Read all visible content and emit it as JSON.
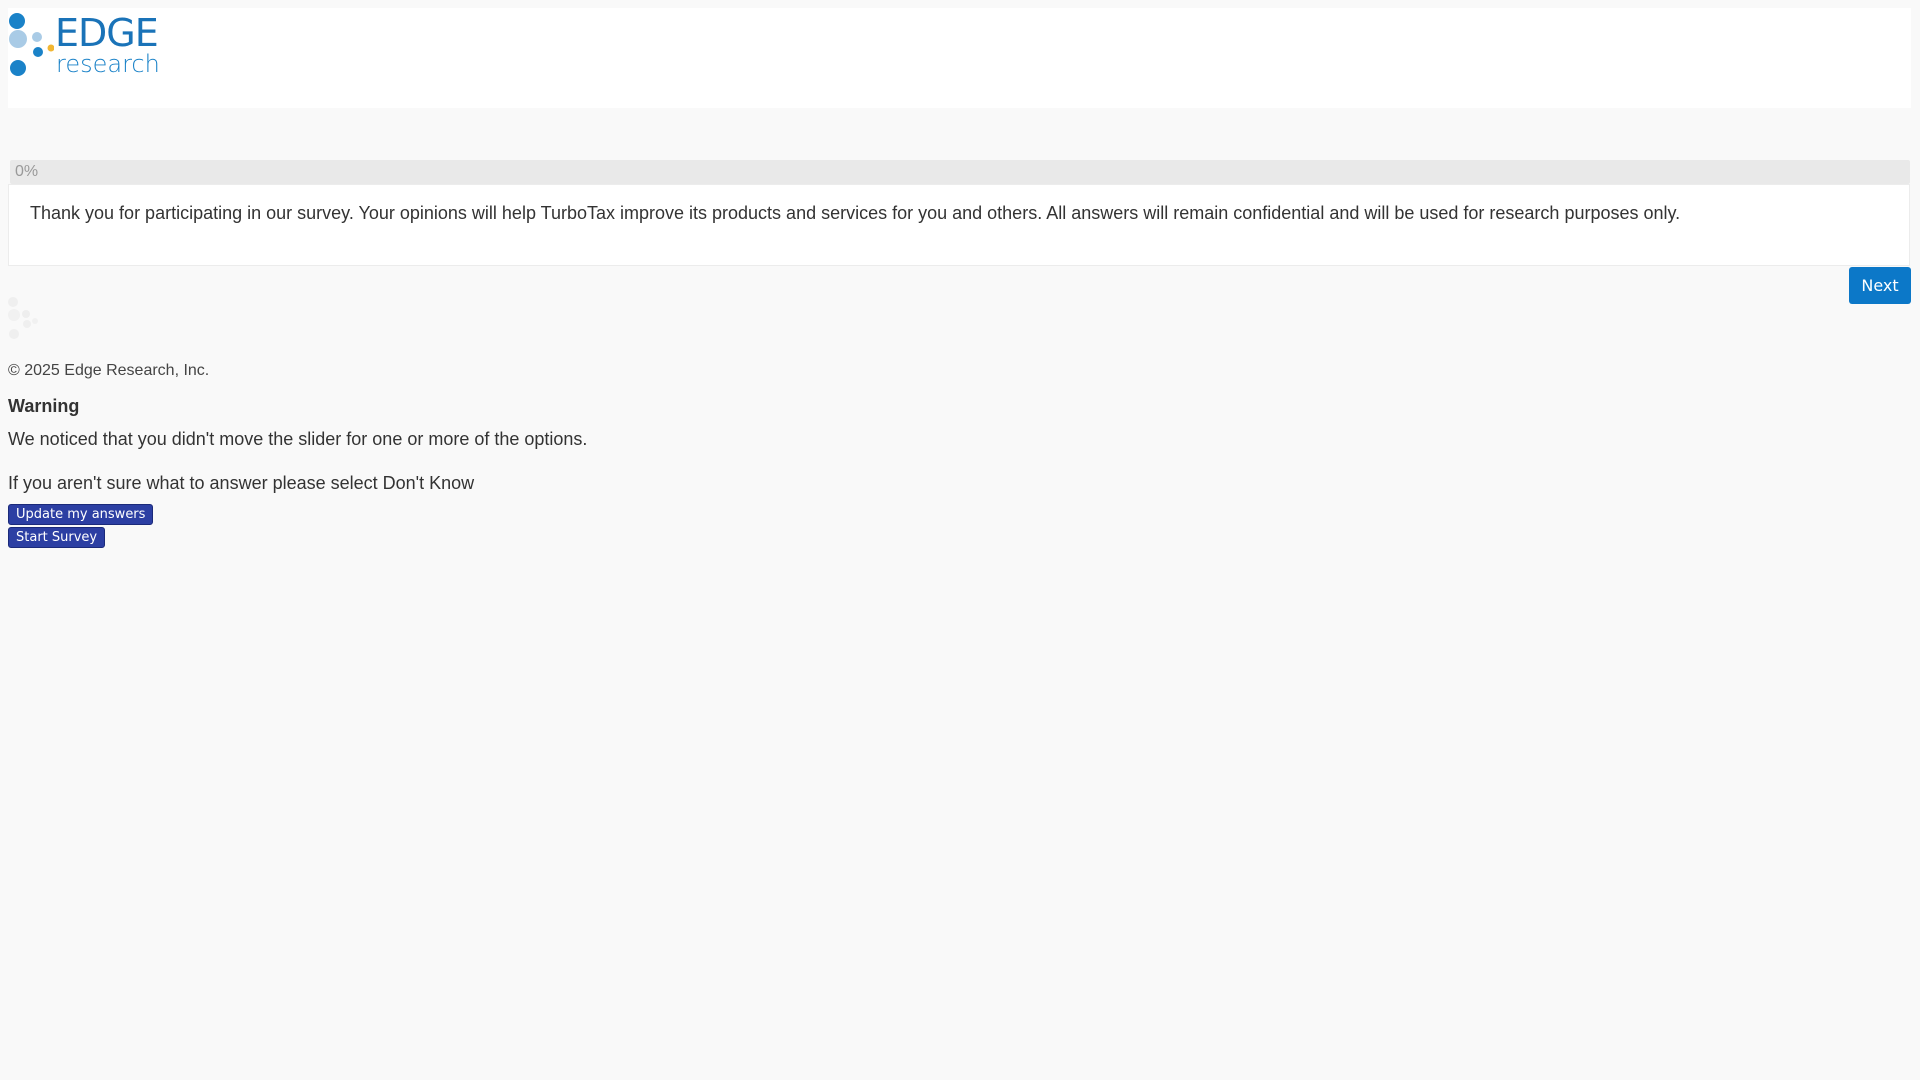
{
  "header": {
    "logo_line1": "EDGE",
    "logo_line2": "research"
  },
  "progress": {
    "label": "0%",
    "value": 0
  },
  "question": {
    "text": "Thank you for participating in our survey. Your opinions will help TurboTax improve its products and services for you and others. All answers will remain confidential and will be used for research purposes only."
  },
  "navigation": {
    "next_label": "Next"
  },
  "footer": {
    "copyright": "© 2025 Edge Research, Inc."
  },
  "warning": {
    "title": "Warning",
    "message": "We noticed that you didn't move the slider for one or more of the options.",
    "hint": "If you aren't sure what to answer please select Don't Know",
    "update_label": "Update my answers",
    "start_label": "Start Survey"
  },
  "colors": {
    "brand_blue": "#1a73b8",
    "light_blue": "#a9cbe6",
    "accent_yellow": "#f2b632",
    "next_button": "#0c78c8",
    "dialog_button": "#2c3fa3"
  }
}
